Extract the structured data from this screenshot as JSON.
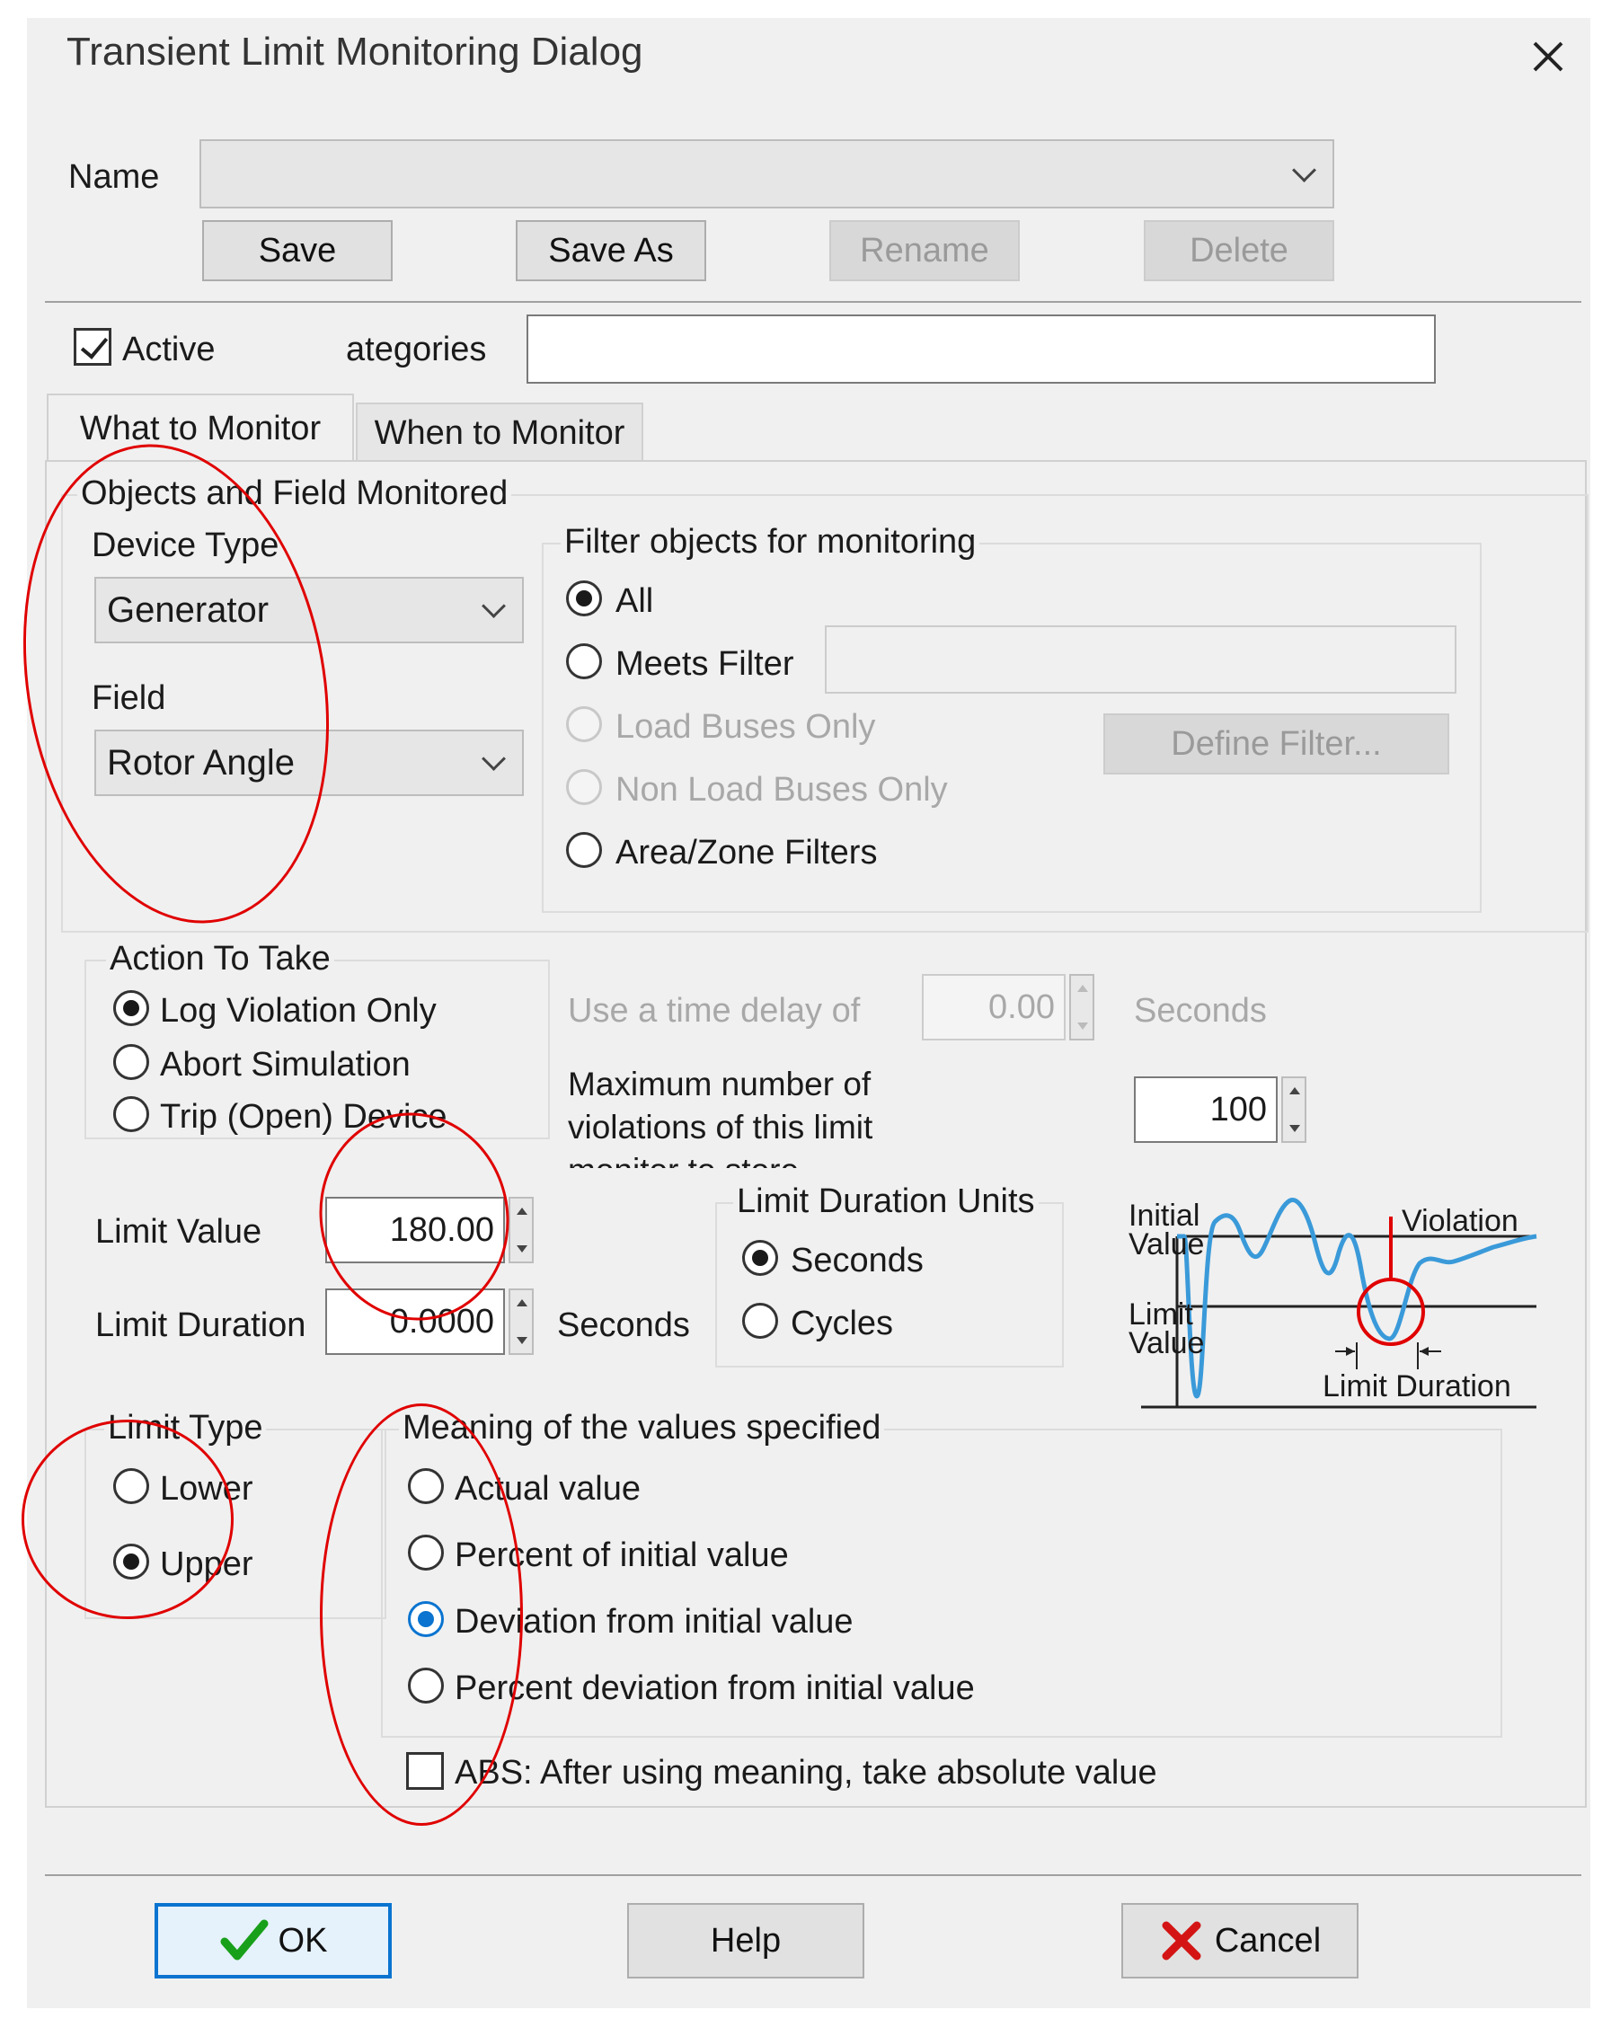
{
  "dialog": {
    "title": "Transient Limit Monitoring Dialog"
  },
  "name_row": {
    "label": "Name",
    "value": ""
  },
  "buttons": {
    "save": "Save",
    "save_as": "Save As",
    "rename": "Rename",
    "delete": "Delete"
  },
  "active": {
    "label": "Active",
    "checked": true
  },
  "categories": {
    "label": "ategories",
    "value": ""
  },
  "tabs": [
    {
      "label": "What to Monitor"
    },
    {
      "label": "When to Monitor"
    }
  ],
  "objects_group": {
    "title": "Objects and Field Monitored",
    "device_type_label": "Device Type",
    "device_type_value": "Generator",
    "field_label": "Field",
    "field_value": "Rotor Angle"
  },
  "filter_group": {
    "title": "Filter objects for monitoring",
    "options": [
      {
        "label": "All",
        "selected": true
      },
      {
        "label": "Meets Filter"
      },
      {
        "label": "Load Buses Only",
        "disabled": true
      },
      {
        "label": "Non Load Buses Only",
        "disabled": true
      },
      {
        "label": "Area/Zone Filters"
      }
    ],
    "define_filter": "Define Filter..."
  },
  "action_group": {
    "title": "Action To Take",
    "options": [
      {
        "label": "Log Violation Only",
        "selected": true
      },
      {
        "label": "Abort Simulation"
      },
      {
        "label": "Trip (Open) Device"
      }
    ]
  },
  "time_delay": {
    "label": "Use a time delay of",
    "value": "0.00",
    "unit": "Seconds"
  },
  "max_violations": {
    "line1": "Maximum number of",
    "line2": "violations of this limit",
    "line3": "monitor to store",
    "value": "100"
  },
  "limit_value": {
    "label": "Limit Value",
    "value": "180.00"
  },
  "limit_duration": {
    "label": "Limit Duration",
    "value": "0.0000",
    "unit": "Seconds"
  },
  "duration_units": {
    "title": "Limit Duration Units",
    "options": [
      {
        "label": "Seconds",
        "selected": true
      },
      {
        "label": "Cycles"
      }
    ]
  },
  "diagram": {
    "initial_1": "Initial",
    "initial_2": "Value",
    "limit_1": "Limit",
    "limit_2": "Value",
    "violation": "Violation",
    "duration": "Limit Duration"
  },
  "limit_type": {
    "title": "Limit Type",
    "options": [
      {
        "label": "Lower"
      },
      {
        "label": "Upper",
        "selected": true
      }
    ]
  },
  "meaning": {
    "title": "Meaning of the values specified",
    "options": [
      {
        "label": "Actual value"
      },
      {
        "label": "Percent of initial value"
      },
      {
        "label": "Deviation from initial value",
        "selected": true
      },
      {
        "label": "Percent deviation from initial value"
      }
    ]
  },
  "abs": {
    "label": "ABS: After using meaning, take absolute value",
    "checked": false
  },
  "footer": {
    "ok": "OK",
    "help": "Help",
    "cancel": "Cancel"
  },
  "colors": {
    "annotation": "#e00000",
    "accent": "#0a74d0",
    "diagram_curve": "#3a9ad9"
  }
}
